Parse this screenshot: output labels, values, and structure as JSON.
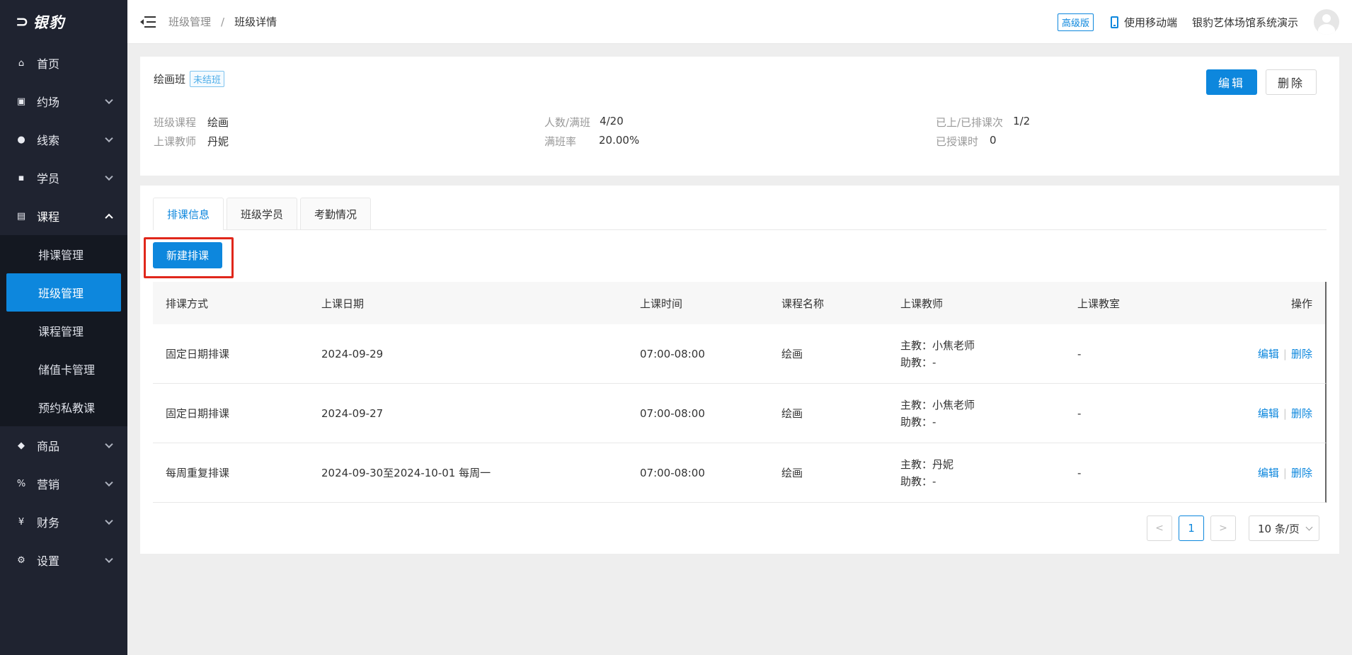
{
  "app": {
    "logo_text": "银豹"
  },
  "sidebar": {
    "items": [
      {
        "label": "首页",
        "icon": "home-icon"
      },
      {
        "label": "约场",
        "icon": "calendar-check-icon"
      },
      {
        "label": "线索",
        "icon": "users-icon"
      },
      {
        "label": "学员",
        "icon": "student-icon"
      },
      {
        "label": "课程",
        "icon": "book-icon"
      },
      {
        "label": "商品",
        "icon": "bag-icon"
      },
      {
        "label": "营销",
        "icon": "percent-icon"
      },
      {
        "label": "财务",
        "icon": "yen-icon"
      },
      {
        "label": "设置",
        "icon": "gear-icon"
      }
    ],
    "course_submenu": [
      "排课管理",
      "班级管理",
      "课程管理",
      "储值卡管理",
      "预约私教课"
    ]
  },
  "header": {
    "breadcrumb": [
      "班级管理",
      "班级详情"
    ],
    "edition_badge": "高级版",
    "mobile_label": "使用移动端",
    "venue_name": "银豹艺体场馆系统演示"
  },
  "class_info": {
    "name": "绘画班",
    "status": "未结班",
    "edit_label": "编辑",
    "delete_label": "删除",
    "fields": {
      "course_label": "班级课程",
      "course_value": "绘画",
      "teacher_label": "上课教师",
      "teacher_value": "丹妮",
      "capacity_label": "人数/满班",
      "capacity_value": "4/20",
      "fill_rate_label": "满班率",
      "fill_rate_value": "20.00%",
      "sessions_label": "已上/已排课次",
      "sessions_value": "1/2",
      "hours_label": "已授课时",
      "hours_value": "0"
    }
  },
  "tabs": [
    "排课信息",
    "班级学员",
    "考勤情况"
  ],
  "new_schedule_label": "新建排课",
  "table": {
    "headers": [
      "排课方式",
      "上课日期",
      "上课时间",
      "课程名称",
      "上课教师",
      "上课教室",
      "操作"
    ],
    "rows": [
      {
        "mode": "固定日期排课",
        "date": "2024-09-29",
        "time": "07:00-08:00",
        "course": "绘画",
        "main_teacher": "主教：小焦老师",
        "assistant": "助教：-",
        "room": "-",
        "edit": "编辑",
        "delete": "删除"
      },
      {
        "mode": "固定日期排课",
        "date": "2024-09-27",
        "time": "07:00-08:00",
        "course": "绘画",
        "main_teacher": "主教：小焦老师",
        "assistant": "助教：-",
        "room": "-",
        "edit": "编辑",
        "delete": "删除"
      },
      {
        "mode": "每周重复排课",
        "date": "2024-09-30至2024-10-01 每周一",
        "time": "07:00-08:00",
        "course": "绘画",
        "main_teacher": "主教：丹妮",
        "assistant": "助教：-",
        "room": "-",
        "edit": "编辑",
        "delete": "删除"
      }
    ]
  },
  "pagination": {
    "current_page": "1",
    "page_size": "10 条/页"
  }
}
